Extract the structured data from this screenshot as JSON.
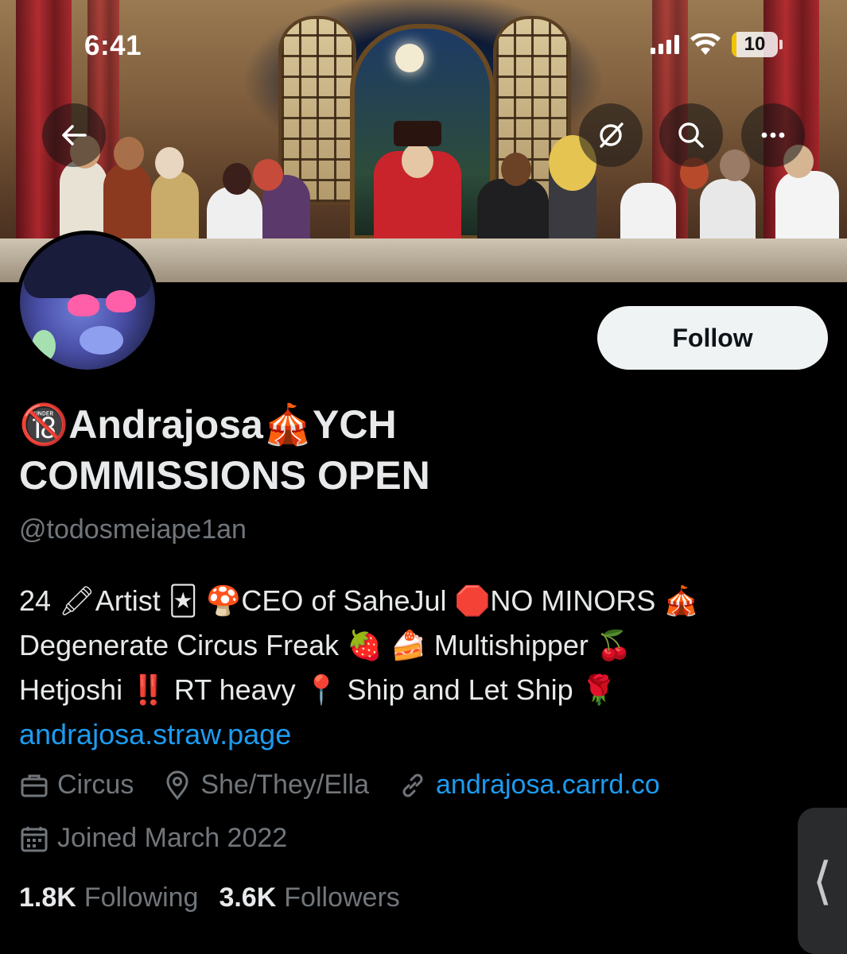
{
  "status_bar": {
    "time": "6:41",
    "battery": "10",
    "battery_level": 0.1
  },
  "header": {
    "back_icon": "arrow-left-icon",
    "grok_icon": "slash-circle-icon",
    "search_icon": "search-icon",
    "more_icon": "more-horizontal-icon"
  },
  "profile": {
    "follow_label": "Follow",
    "display_name": "🔞Andrajosa🎪YCH COMMISSIONS OPEN",
    "handle": "@todosmeiape1an",
    "bio_lines": [
      "24 🖍Artist 🃏 🍄CEO of SaheJul 🛑NO MINORS 🎪",
      "Degenerate Circus Freak 🍓 🍰 Multishipper 🍒",
      "Hetjoshi ‼️ RT heavy 📍 Ship and Let Ship 🌹"
    ],
    "bio_link": "andrajosa.straw.page",
    "category": "Circus",
    "location": "She/They/Ella",
    "website": "andrajosa.carrd.co",
    "joined": "Joined March 2022",
    "following_count": "1.8K",
    "following_label": "Following",
    "followers_count": "3.6K",
    "followers_label": "Followers"
  },
  "side_tab_glyph": "⟨",
  "colors": {
    "accent": "#1d9bf0",
    "secondary_text": "#71767b",
    "primary_text": "#e7e9ea"
  }
}
